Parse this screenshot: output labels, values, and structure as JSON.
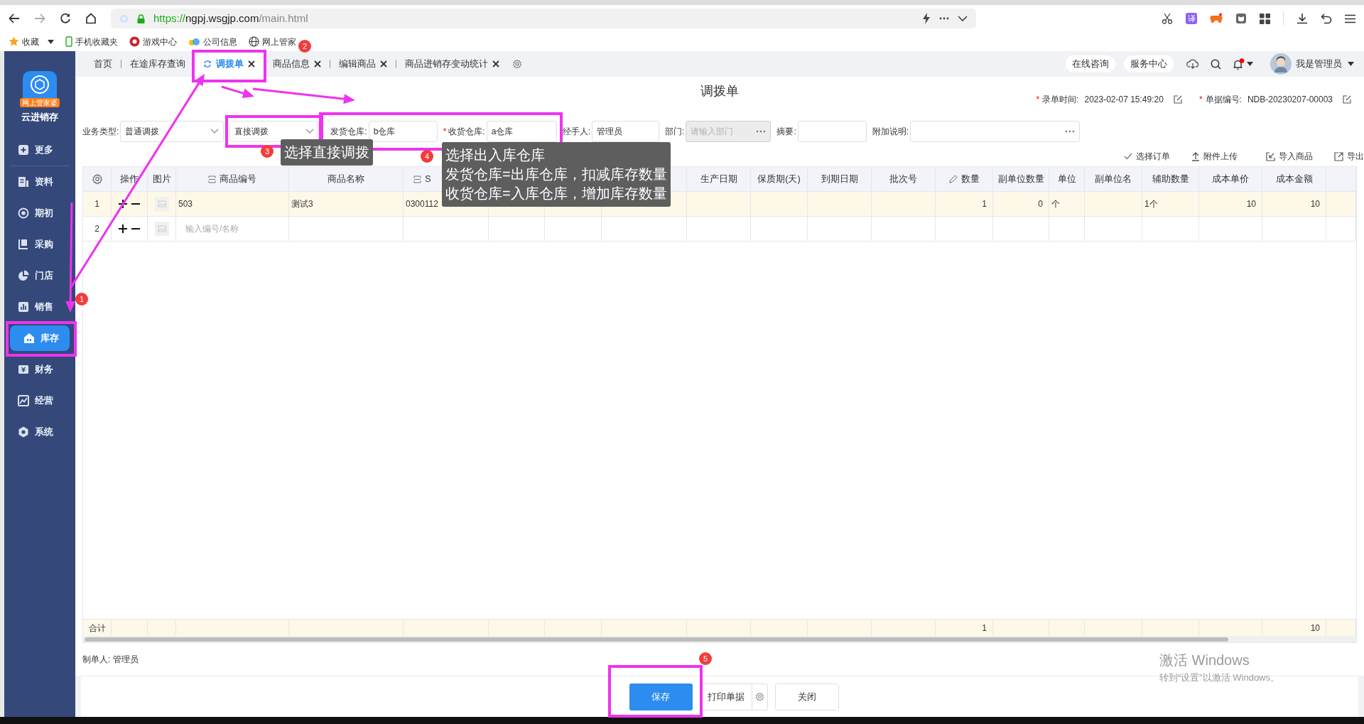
{
  "browser": {
    "url": {
      "scheme": "https://",
      "host": "ngpj.wsgjp.com",
      "path": "/main.html"
    },
    "translate_badge": "译",
    "bookmarks": [
      {
        "label": "收藏",
        "dropdown": true
      },
      {
        "label": "手机收藏夹",
        "dropdown": false
      },
      {
        "label": "游戏中心",
        "dropdown": false
      },
      {
        "label": "公司信息",
        "dropdown": false
      },
      {
        "label": "网上管家",
        "dropdown": false
      }
    ]
  },
  "app": {
    "logo_badge": "网上管家婆",
    "name": "云进销存"
  },
  "sidebar": [
    {
      "label": "更多",
      "selected": false
    },
    {
      "label": "资料",
      "selected": false
    },
    {
      "label": "期初",
      "selected": false
    },
    {
      "label": "采购",
      "selected": false
    },
    {
      "label": "门店",
      "selected": false
    },
    {
      "label": "销售",
      "selected": false
    },
    {
      "label": "库存",
      "selected": true
    },
    {
      "label": "财务",
      "selected": false
    },
    {
      "label": "经营",
      "selected": false
    },
    {
      "label": "系统",
      "selected": false
    }
  ],
  "tabs": [
    {
      "label": "首页",
      "selected": false,
      "closable": false
    },
    {
      "label": "在途库存查询",
      "selected": false,
      "closable": false
    },
    {
      "label": "调拨单",
      "selected": true,
      "closable": true
    },
    {
      "label": "商品信息",
      "selected": false,
      "closable": true
    },
    {
      "label": "编辑商品",
      "selected": false,
      "closable": true
    },
    {
      "label": "商品进销存变动统计",
      "selected": false,
      "closable": true
    }
  ],
  "header_actions": [
    "在线咨询",
    "服务中心"
  ],
  "notifications": {
    "unread": true
  },
  "user": "我是管理员",
  "form": {
    "title": "调拨单",
    "meta": [
      {
        "mark": "*",
        "label": "录单时间:",
        "value": "2023-02-07 15:49:20"
      },
      {
        "mark": "*",
        "label": "单据编号:",
        "value": "NDB-20230207-00003"
      }
    ],
    "fields": [
      {
        "label": "业务类型:",
        "kind": "select",
        "value": "普通调拨",
        "disabled": false
      },
      {
        "kind": "select",
        "value": "直接调拨",
        "disabled": false
      },
      {
        "label": "发货仓库:",
        "kind": "input",
        "value": "b仓库",
        "disabled": false
      },
      {
        "mark": "*",
        "label": "收货仓库:",
        "kind": "input",
        "value": "a仓库",
        "disabled": false
      },
      {
        "label": "经手人:",
        "kind": "input",
        "value": "管理员",
        "disabled": false
      },
      {
        "label": "部门:",
        "kind": "picker",
        "placeholder": "请输入部门",
        "disabled": true
      },
      {
        "label": "摘要:",
        "kind": "input",
        "disabled": false
      },
      {
        "label": "附加说明:",
        "kind": "picker",
        "disabled": false
      }
    ]
  },
  "toolbar": [
    "选择订单",
    "附件上传",
    "导入商品",
    "导出"
  ],
  "table": {
    "columns": [
      {
        "label": "操作",
        "kind": "text"
      },
      {
        "label": "图片",
        "kind": "text"
      },
      {
        "label": "商品编号",
        "kind": "lookup"
      },
      {
        "label": "商品名称",
        "kind": "text"
      },
      {
        "label": "S",
        "kind": "lookup"
      },
      {
        "kind": "text"
      },
      {
        "kind": "text"
      },
      {
        "kind": "text"
      },
      {
        "label": "生产日期",
        "kind": "text"
      },
      {
        "label": "保质期(天)",
        "kind": "text"
      },
      {
        "label": "到期日期",
        "kind": "text"
      },
      {
        "label": "批次号",
        "kind": "text"
      },
      {
        "label": "数量",
        "kind": "editable"
      },
      {
        "label": "副单位数量",
        "kind": "text"
      },
      {
        "label": "单位",
        "kind": "text"
      },
      {
        "label": "副单位名",
        "kind": "text"
      },
      {
        "label": "辅助数量",
        "kind": "text"
      },
      {
        "label": "成本单价",
        "kind": "text"
      },
      {
        "label": "成本金额",
        "kind": "text"
      },
      {
        "kind": "text"
      }
    ],
    "rows": [
      {
        "index": "1",
        "selected": true,
        "cells": [
          null,
          null,
          "503",
          "测试3",
          "0300112",
          null,
          null,
          null,
          null,
          null,
          null,
          null,
          "1",
          "0",
          "个",
          null,
          "1个",
          "10",
          "10",
          null
        ]
      },
      {
        "index": "2",
        "selected": false,
        "placeholder": "输入编号/名称",
        "cells": [
          null,
          null,
          null,
          null,
          null,
          null,
          null,
          null,
          null,
          null,
          null,
          null,
          null,
          null,
          null,
          null,
          null,
          null,
          null,
          null
        ]
      }
    ],
    "totals": {
      "label": "合计",
      "cells": [
        null,
        null,
        null,
        null,
        null,
        null,
        null,
        null,
        null,
        null,
        null,
        null,
        "1",
        null,
        null,
        null,
        null,
        null,
        "10",
        null
      ]
    }
  },
  "footer": {
    "creator": "制单人: 管理员",
    "buttons": [
      {
        "label": "保存",
        "primary": true,
        "settings": false
      },
      {
        "label": "打印单据",
        "primary": false,
        "settings": true
      },
      {
        "label": "关闭",
        "primary": false,
        "settings": false
      }
    ]
  },
  "annotations": {
    "badges": [
      "1",
      "2",
      "3",
      "4",
      "5"
    ],
    "tips": [
      [
        "选择直接调拨"
      ],
      [
        "选择出入库仓库",
        "发货仓库=出库仓库，扣减库存数量",
        "收货仓库=入库仓库，增加库存数量"
      ]
    ]
  },
  "windows_notice": {
    "title": "激活 Windows",
    "text": "转到“设置”以激活 Windows。"
  }
}
